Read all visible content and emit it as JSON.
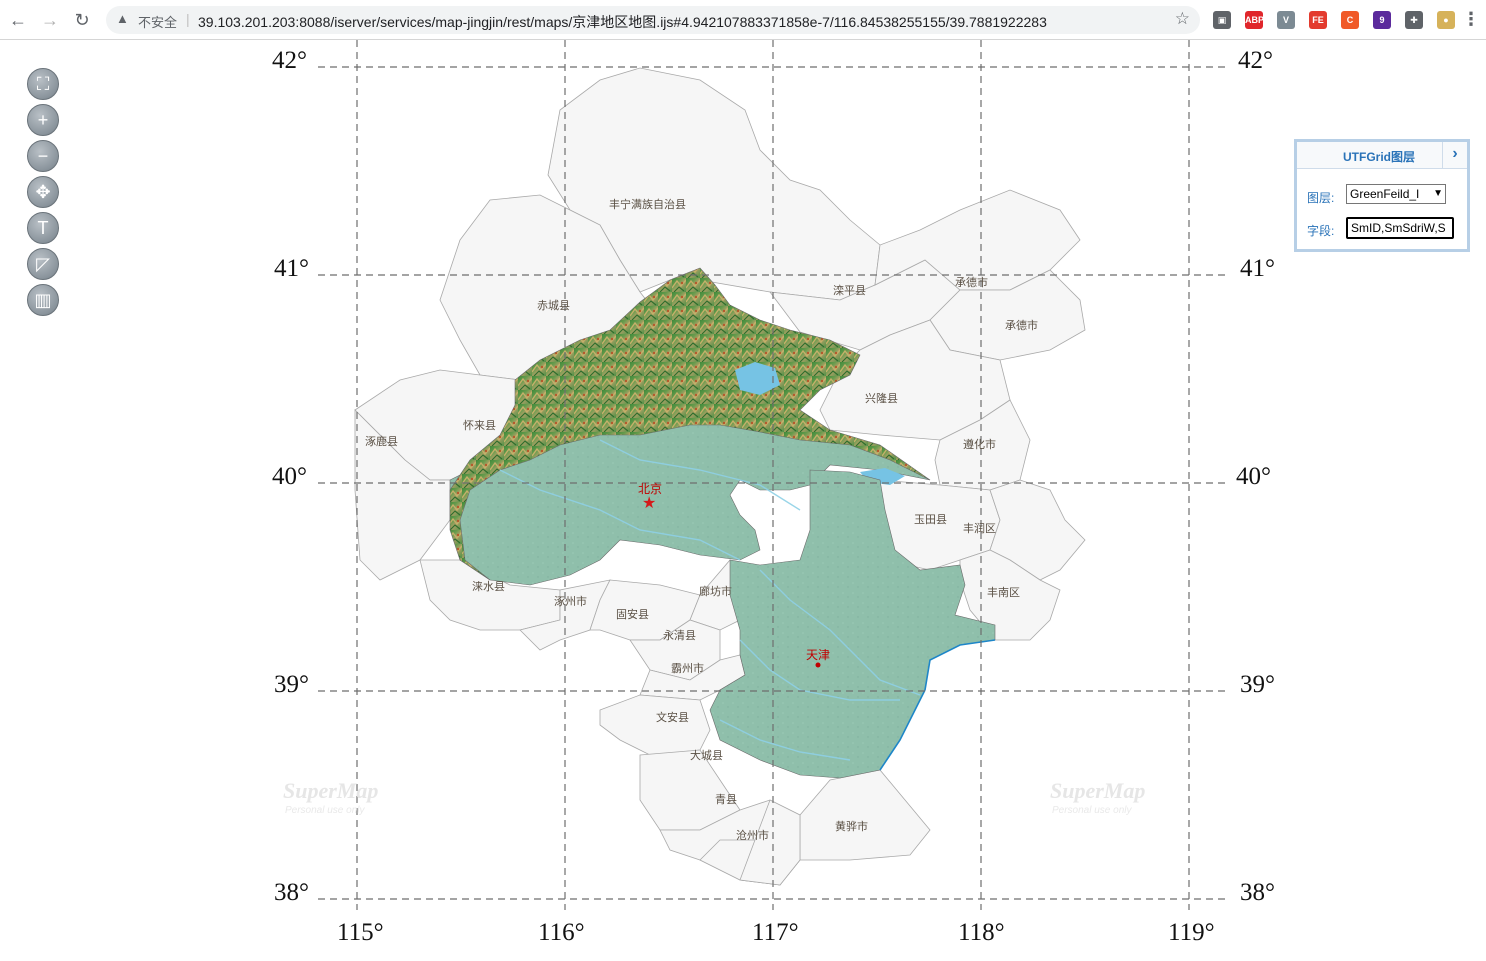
{
  "browser": {
    "security_label": "不安全",
    "url": "39.103.201.203:8088/iserver/services/map-jingjin/rest/maps/京津地区地图.ijs#4.942107883371858e-7/116.84538255155/39.7881922283",
    "extensions": [
      {
        "name": "screenshot-ext",
        "text": "▣",
        "color": "#5f6368"
      },
      {
        "name": "adblock-plus-ext",
        "text": "ABP",
        "color": "#e0262b"
      },
      {
        "name": "vue-devtools-ext",
        "text": "V",
        "color": "#7c8a93"
      },
      {
        "name": "fe-helper-ext",
        "text": "FE",
        "color": "#e33b2e"
      },
      {
        "name": "c-ext",
        "text": "C",
        "color": "#f05a28"
      },
      {
        "name": "badge-ext",
        "text": "9",
        "color": "#5b2a9c"
      },
      {
        "name": "puzzle-ext",
        "text": "✚",
        "color": "#5f6368"
      },
      {
        "name": "avatar-ext",
        "text": "●",
        "color": "#d6b25a"
      }
    ]
  },
  "map": {
    "lat_labels": [
      "42°",
      "41°",
      "40°",
      "39°",
      "38°"
    ],
    "lon_labels": [
      "115°",
      "116°",
      "117°",
      "118°",
      "119°"
    ],
    "watermark_text": "SuperMap",
    "watermark_sub": "Personal use only",
    "places": [
      {
        "name": "丰宁满族自治县"
      },
      {
        "name": "赤城县"
      },
      {
        "name": "滦平县"
      },
      {
        "name": "承德市"
      },
      {
        "name": "承德市"
      },
      {
        "name": "兴隆县"
      },
      {
        "name": "怀来县"
      },
      {
        "name": "涿鹿县"
      },
      {
        "name": "遵化市"
      },
      {
        "name": "玉田县"
      },
      {
        "name": "丰润区"
      },
      {
        "name": "丰南区"
      },
      {
        "name": "涞水县"
      },
      {
        "name": "涿州市"
      },
      {
        "name": "固安县"
      },
      {
        "name": "廊坊市"
      },
      {
        "name": "永清县"
      },
      {
        "name": "霸州市"
      },
      {
        "name": "文安县"
      },
      {
        "name": "大城县"
      },
      {
        "name": "青县"
      },
      {
        "name": "沧州市"
      },
      {
        "name": "黄骅市"
      }
    ],
    "capitals": [
      {
        "name": "北京"
      },
      {
        "name": "天津"
      }
    ]
  },
  "toolbar": {
    "tools": [
      {
        "name": "full-extent-button",
        "icon": "⛶"
      },
      {
        "name": "zoom-in-button",
        "icon": "+"
      },
      {
        "name": "zoom-out-button",
        "icon": "−"
      },
      {
        "name": "pan-button",
        "icon": "✥"
      },
      {
        "name": "measure-distance-button",
        "icon": "T"
      },
      {
        "name": "measure-area-button",
        "icon": "◸"
      },
      {
        "name": "clear-button",
        "icon": "▥"
      }
    ]
  },
  "panel": {
    "title": "UTFGrid图层",
    "layer_label": "图层:",
    "layer_value": "GreenFeild_I",
    "field_label": "字段:",
    "field_value": "SmID,SmSdriW,S"
  }
}
